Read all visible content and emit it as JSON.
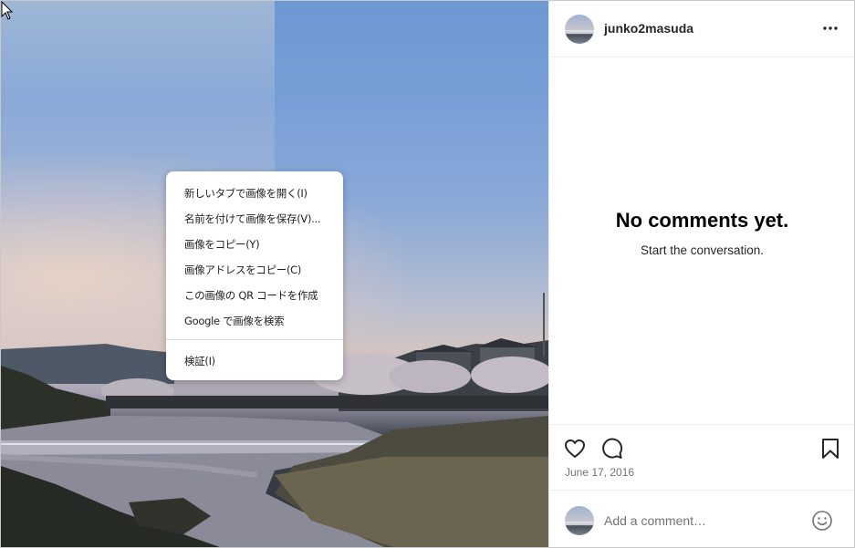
{
  "post": {
    "username": "junko2masuda",
    "date": "June 17, 2016",
    "comments_empty_title": "No comments yet.",
    "comments_empty_subtitle": "Start the conversation.",
    "comment_placeholder": "Add a comment…"
  },
  "context_menu": {
    "items": [
      "新しいタブで画像を開く(I)",
      "名前を付けて画像を保存(V)...",
      "画像をコピー(Y)",
      "画像アドレスをコピー(C)",
      "この画像の QR コードを作成",
      "Google で画像を検索"
    ],
    "inspect": "検証(I)"
  },
  "icons": {
    "more": "more-horizontal-icon",
    "like": "heart-icon",
    "comment": "comment-bubble-icon",
    "save": "bookmark-icon",
    "emoji": "smiley-icon"
  }
}
